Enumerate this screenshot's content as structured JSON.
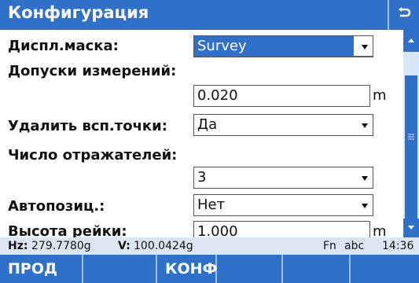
{
  "titlebar": {
    "title": "Конфигурация"
  },
  "form": {
    "display_mask_label": "Диспл.маска:",
    "display_mask_value": "Survey",
    "tolerance_label": "Допуски измерений:",
    "tolerance_value": "0.020",
    "tolerance_unit": "m",
    "delete_aux_label": "Удалить всп.точки:",
    "delete_aux_value": "Да",
    "reflectors_label": "Число отражателей:",
    "reflectors_value": "3",
    "autopos_label": "Автопозиц.:",
    "autopos_value": "Нет",
    "rod_height_label": "Высота рейки:",
    "rod_height_value": "1.000",
    "rod_height_unit": "m"
  },
  "status": {
    "hz_label": "Hz:",
    "hz_value": "279.7780g",
    "v_label": "V:",
    "v_value": "100.0424g",
    "fn": "Fn",
    "input_mode": "abc",
    "time": "14:36"
  },
  "softkeys": [
    "ПРОД",
    "",
    "КОНФ",
    "",
    "",
    ""
  ],
  "colors": {
    "accent": "#2f70c8",
    "status_bg": "#dde7f3"
  }
}
